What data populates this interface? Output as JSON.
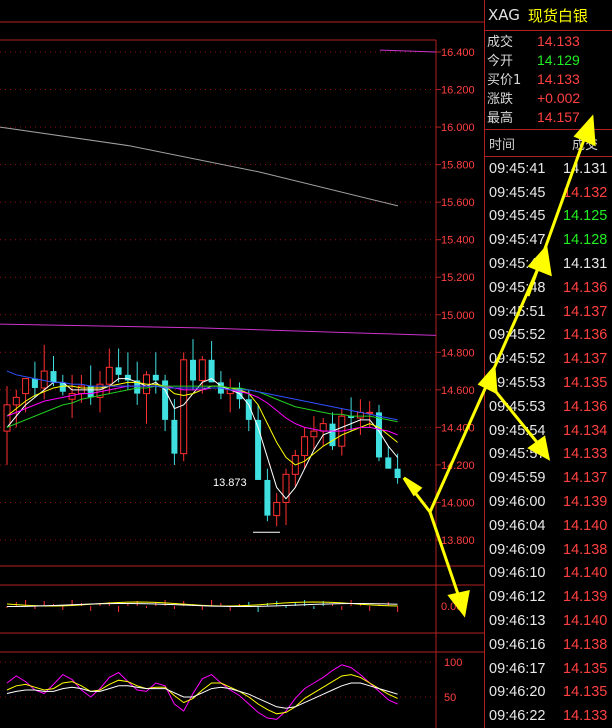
{
  "quote": {
    "symbol": "XAG",
    "name": "现货白银",
    "rows": [
      {
        "label": "成交",
        "value": "14.133",
        "color": "#ff4040"
      },
      {
        "label": "今开",
        "value": "14.129",
        "color": "#22ee22"
      },
      {
        "label": "买价1",
        "value": "14.133",
        "color": "#ff4040"
      },
      {
        "label": "涨跌",
        "value": "+0.002",
        "color": "#ff4040"
      },
      {
        "label": "最高",
        "value": "14.157",
        "color": "#ff4040"
      }
    ]
  },
  "ticks": {
    "header_time": "时间",
    "header_price": "成交",
    "rows": [
      {
        "time": "09:45:41",
        "price": "14.131",
        "color": "#e8e8e8"
      },
      {
        "time": "09:45:45",
        "price": "14.132",
        "color": "#ff4040"
      },
      {
        "time": "09:45:45",
        "price": "14.125",
        "color": "#22ee22"
      },
      {
        "time": "09:45:47",
        "price": "14.128",
        "color": "#22ee22"
      },
      {
        "time": "09:45:47",
        "price": "14.131",
        "color": "#e8e8e8"
      },
      {
        "time": "09:45:48",
        "price": "14.136",
        "color": "#ff4040"
      },
      {
        "time": "09:45:51",
        "price": "14.137",
        "color": "#ff4040"
      },
      {
        "time": "09:45:52",
        "price": "14.136",
        "color": "#ff4040"
      },
      {
        "time": "09:45:52",
        "price": "14.137",
        "color": "#ff4040"
      },
      {
        "time": "09:45:53",
        "price": "14.135",
        "color": "#ff4040"
      },
      {
        "time": "09:45:53",
        "price": "14.136",
        "color": "#ff4040"
      },
      {
        "time": "09:45:54",
        "price": "14.134",
        "color": "#ff4040"
      },
      {
        "time": "09:45:57",
        "price": "14.133",
        "color": "#ff4040"
      },
      {
        "time": "09:45:59",
        "price": "14.137",
        "color": "#ff4040"
      },
      {
        "time": "09:46:00",
        "price": "14.139",
        "color": "#ff4040"
      },
      {
        "time": "09:46:04",
        "price": "14.140",
        "color": "#ff4040"
      },
      {
        "time": "09:46:09",
        "price": "14.138",
        "color": "#ff4040"
      },
      {
        "time": "09:46:10",
        "price": "14.140",
        "color": "#ff4040"
      },
      {
        "time": "09:46:12",
        "price": "14.139",
        "color": "#ff4040"
      },
      {
        "time": "09:46:13",
        "price": "14.140",
        "color": "#ff4040"
      },
      {
        "time": "09:46:16",
        "price": "14.138",
        "color": "#ff4040"
      },
      {
        "time": "09:46:17",
        "price": "14.135",
        "color": "#ff4040"
      },
      {
        "time": "09:46:20",
        "price": "14.135",
        "color": "#ff4040"
      },
      {
        "time": "09:46:22",
        "price": "14.133",
        "color": "#ff4040"
      }
    ]
  },
  "chart_data": {
    "type": "candlestick",
    "price_axis": {
      "min": 13.8,
      "max": 16.4,
      "ticks": [
        "16.400",
        "16.200",
        "16.000",
        "15.800",
        "15.600",
        "15.400",
        "15.200",
        "15.000",
        "14.800",
        "14.600",
        "14.400",
        "14.200",
        "14.000",
        "13.800"
      ]
    },
    "low_label": "13.873",
    "candles": [
      {
        "o": 14.38,
        "h": 14.62,
        "l": 14.2,
        "c": 14.52
      },
      {
        "o": 14.52,
        "h": 14.6,
        "l": 14.4,
        "c": 14.56
      },
      {
        "o": 14.58,
        "h": 14.66,
        "l": 14.48,
        "c": 14.66
      },
      {
        "o": 14.66,
        "h": 14.75,
        "l": 14.56,
        "c": 14.61
      },
      {
        "o": 14.61,
        "h": 14.84,
        "l": 14.55,
        "c": 14.7
      },
      {
        "o": 14.7,
        "h": 14.78,
        "l": 14.62,
        "c": 14.64
      },
      {
        "o": 14.64,
        "h": 14.68,
        "l": 14.57,
        "c": 14.59
      },
      {
        "o": 14.55,
        "h": 14.68,
        "l": 14.45,
        "c": 14.58
      },
      {
        "o": 14.58,
        "h": 14.68,
        "l": 14.53,
        "c": 14.62
      },
      {
        "o": 14.62,
        "h": 14.73,
        "l": 14.52,
        "c": 14.56
      },
      {
        "o": 14.56,
        "h": 14.7,
        "l": 14.48,
        "c": 14.63
      },
      {
        "o": 14.63,
        "h": 14.82,
        "l": 14.58,
        "c": 14.72
      },
      {
        "o": 14.72,
        "h": 14.82,
        "l": 14.64,
        "c": 14.68
      },
      {
        "o": 14.68,
        "h": 14.8,
        "l": 14.6,
        "c": 14.65
      },
      {
        "o": 14.65,
        "h": 14.75,
        "l": 14.52,
        "c": 14.58
      },
      {
        "o": 14.58,
        "h": 14.7,
        "l": 14.42,
        "c": 14.68
      },
      {
        "o": 14.68,
        "h": 14.8,
        "l": 14.58,
        "c": 14.65
      },
      {
        "o": 14.65,
        "h": 14.68,
        "l": 14.38,
        "c": 14.44
      },
      {
        "o": 14.44,
        "h": 14.55,
        "l": 14.2,
        "c": 14.26
      },
      {
        "o": 14.26,
        "h": 14.8,
        "l": 14.22,
        "c": 14.76
      },
      {
        "o": 14.76,
        "h": 14.87,
        "l": 14.6,
        "c": 14.65
      },
      {
        "o": 14.65,
        "h": 14.78,
        "l": 14.58,
        "c": 14.76
      },
      {
        "o": 14.76,
        "h": 14.86,
        "l": 14.64,
        "c": 14.64
      },
      {
        "o": 14.64,
        "h": 14.7,
        "l": 14.55,
        "c": 14.58
      },
      {
        "o": 14.58,
        "h": 14.66,
        "l": 14.48,
        "c": 14.61
      },
      {
        "o": 14.61,
        "h": 14.64,
        "l": 14.5,
        "c": 14.55
      },
      {
        "o": 14.55,
        "h": 14.6,
        "l": 14.38,
        "c": 14.44
      },
      {
        "o": 14.44,
        "h": 14.52,
        "l": 14.12,
        "c": 14.12
      },
      {
        "o": 14.12,
        "h": 14.18,
        "l": 13.9,
        "c": 13.93
      },
      {
        "o": 13.93,
        "h": 14.05,
        "l": 13.873,
        "c": 14.0
      },
      {
        "o": 14.0,
        "h": 14.18,
        "l": 13.88,
        "c": 14.15
      },
      {
        "o": 14.15,
        "h": 14.28,
        "l": 14.08,
        "c": 14.25
      },
      {
        "o": 14.25,
        "h": 14.4,
        "l": 14.18,
        "c": 14.35
      },
      {
        "o": 14.35,
        "h": 14.46,
        "l": 14.28,
        "c": 14.38
      },
      {
        "o": 14.38,
        "h": 14.45,
        "l": 14.3,
        "c": 14.42
      },
      {
        "o": 14.42,
        "h": 14.48,
        "l": 14.28,
        "c": 14.3
      },
      {
        "o": 14.3,
        "h": 14.5,
        "l": 14.25,
        "c": 14.46
      },
      {
        "o": 14.46,
        "h": 14.56,
        "l": 14.38,
        "c": 14.45
      },
      {
        "o": 14.45,
        "h": 14.55,
        "l": 14.36,
        "c": 14.48
      },
      {
        "o": 14.48,
        "h": 14.54,
        "l": 14.4,
        "c": 14.48
      },
      {
        "o": 14.48,
        "h": 14.52,
        "l": 14.22,
        "c": 14.24
      },
      {
        "o": 14.24,
        "h": 14.3,
        "l": 14.18,
        "c": 14.18
      },
      {
        "o": 14.18,
        "h": 14.26,
        "l": 14.1,
        "c": 14.13
      }
    ],
    "ma_lines": [
      {
        "color": "#ffffff",
        "values": [
          14.4,
          14.46,
          14.52,
          14.56,
          14.6,
          14.64,
          14.64,
          14.6,
          14.6,
          14.6,
          14.6,
          14.62,
          14.66,
          14.66,
          14.64,
          14.62,
          14.64,
          14.6,
          14.5,
          14.52,
          14.58,
          14.64,
          14.66,
          14.62,
          14.6,
          14.58,
          14.52,
          14.4,
          14.24,
          14.08,
          14.02,
          14.08,
          14.18,
          14.28,
          14.36,
          14.38,
          14.4,
          14.42,
          14.44,
          14.44,
          14.38,
          14.3,
          14.24
        ]
      },
      {
        "color": "#ffff00",
        "values": [
          14.46,
          14.5,
          14.54,
          14.57,
          14.59,
          14.61,
          14.62,
          14.62,
          14.61,
          14.61,
          14.61,
          14.62,
          14.63,
          14.64,
          14.64,
          14.63,
          14.63,
          14.62,
          14.58,
          14.57,
          14.58,
          14.6,
          14.62,
          14.62,
          14.61,
          14.6,
          14.58,
          14.52,
          14.42,
          14.32,
          14.24,
          14.2,
          14.22,
          14.26,
          14.3,
          14.33,
          14.36,
          14.38,
          14.4,
          14.42,
          14.4,
          14.36,
          14.32
        ]
      },
      {
        "color": "#ff00ff",
        "values": [
          14.46,
          14.48,
          14.5,
          14.52,
          14.54,
          14.55,
          14.56,
          14.57,
          14.58,
          14.58,
          14.59,
          14.6,
          14.61,
          14.62,
          14.62,
          14.62,
          14.62,
          14.62,
          14.61,
          14.6,
          14.6,
          14.6,
          14.61,
          14.61,
          14.6,
          14.59,
          14.58,
          14.56,
          14.53,
          14.49,
          14.45,
          14.42,
          14.4,
          14.39,
          14.38,
          14.38,
          14.38,
          14.39,
          14.4,
          14.4,
          14.39,
          14.38,
          14.36
        ]
      },
      {
        "color": "#22cc22",
        "values": [
          14.4,
          14.42,
          14.44,
          14.46,
          14.48,
          14.5,
          14.52,
          14.53,
          14.55,
          14.56,
          14.57,
          14.58,
          14.59,
          14.6,
          14.61,
          14.61,
          14.62,
          14.62,
          14.62,
          14.62,
          14.62,
          14.62,
          14.62,
          14.62,
          14.61,
          14.61,
          14.6,
          14.59,
          14.57,
          14.55,
          14.53,
          14.51,
          14.5,
          14.49,
          14.48,
          14.47,
          14.47,
          14.46,
          14.46,
          14.46,
          14.45,
          14.44,
          14.43
        ]
      },
      {
        "color": "#3050ff",
        "values": [
          14.7,
          14.68,
          14.67,
          14.66,
          14.65,
          14.64,
          14.64,
          14.63,
          14.63,
          14.62,
          14.62,
          14.62,
          14.62,
          14.62,
          14.62,
          14.62,
          14.62,
          14.61,
          14.61,
          14.61,
          14.61,
          14.61,
          14.61,
          14.61,
          14.6,
          14.6,
          14.6,
          14.59,
          14.58,
          14.57,
          14.56,
          14.55,
          14.54,
          14.53,
          14.52,
          14.51,
          14.5,
          14.49,
          14.48,
          14.47,
          14.46,
          14.45,
          14.44
        ]
      }
    ],
    "long_lines": [
      {
        "color": "#a0a0a0",
        "points": [
          [
            0,
            16.0
          ],
          [
            130,
            15.9
          ],
          [
            260,
            15.76
          ],
          [
            398,
            15.58
          ]
        ]
      },
      {
        "color": "#cc33cc",
        "points": [
          [
            0,
            14.95
          ],
          [
            200,
            14.93
          ],
          [
            436,
            14.89
          ]
        ]
      },
      {
        "color": "#cc33cc",
        "points": [
          [
            380,
            16.41
          ],
          [
            436,
            16.4
          ]
        ]
      }
    ],
    "vol_axis": {
      "tick": "0.00"
    },
    "osc_axis": {
      "ticks": [
        "100",
        "50"
      ]
    }
  }
}
